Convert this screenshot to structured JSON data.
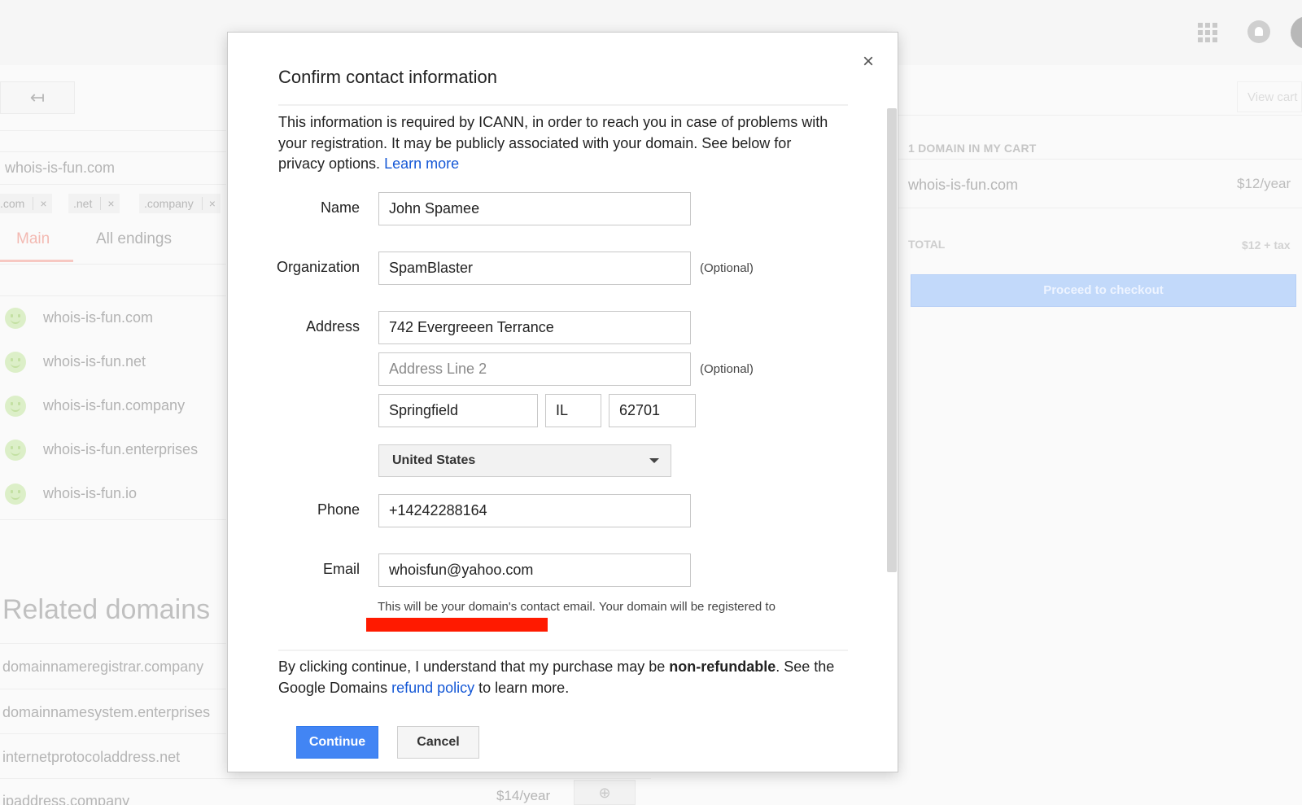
{
  "background": {
    "back_icon": "↤",
    "search_value": "whois-is-fun.com",
    "chips": [
      {
        "label": ".com",
        "close": "×"
      },
      {
        "label": ".net",
        "close": "×"
      },
      {
        "label": ".company",
        "close": "×"
      }
    ],
    "tabs": {
      "main": "Main",
      "all": "All endings"
    },
    "results": [
      "whois-is-fun.com",
      "whois-is-fun.net",
      "whois-is-fun.company",
      "whois-is-fun.enterprises",
      "whois-is-fun.io"
    ],
    "related_title": "Related domains",
    "related": [
      "domainnameregistrar.company",
      "domainnamesystem.enterprises",
      "internetprotocoladdress.net",
      "ipaddress.company"
    ],
    "related_price": "$14/year",
    "cart": {
      "view_cart": "View cart",
      "count_label": "1 DOMAIN IN MY CART",
      "domain": "whois-is-fun.com",
      "price": "$12/year",
      "total_label": "TOTAL",
      "total_value": "$12 + tax",
      "checkout": "Proceed to checkout"
    }
  },
  "modal": {
    "title": "Confirm contact information",
    "close_icon": "×",
    "intro": "This information is required by ICANN, in order to reach you in case of problems with your registration. It may be publicly associated with your domain. See below for privacy options.",
    "learn_more": "Learn more",
    "labels": {
      "name": "Name",
      "organization": "Organization",
      "address": "Address",
      "phone": "Phone",
      "email": "Email"
    },
    "optional": "(Optional)",
    "values": {
      "name": "John Spamee",
      "organization": "SpamBlaster",
      "address1": "742 Evergreeen Terrance",
      "address2_placeholder": "Address Line 2",
      "city": "Springfield",
      "state": "IL",
      "zip": "62701",
      "country": "United States",
      "phone": "+14242288164",
      "email": "whoisfun@yahoo.com"
    },
    "email_help": "This will be your domain's contact email. Your domain will be registered to",
    "footer": {
      "part1": "By clicking continue, I understand that my purchase may be ",
      "bold": "non-refundable",
      "part2": ". See the Google Domains ",
      "link": "refund policy",
      "part3": " to learn more."
    },
    "continue": "Continue",
    "cancel": "Cancel"
  }
}
